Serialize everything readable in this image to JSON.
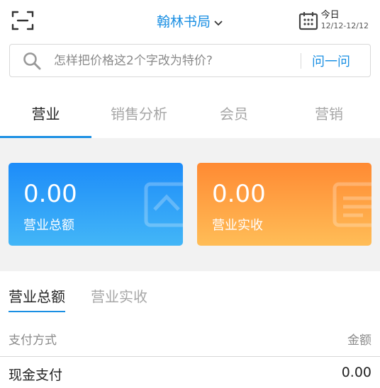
{
  "header": {
    "store_name": "翰林书局",
    "date_label": "今日",
    "date_range": "12/12-12/12",
    "accent_color": "#1a8fe3"
  },
  "search": {
    "placeholder": "怎样把价格这2个字改为特价?",
    "ask_label": "问一问"
  },
  "tabs": [
    {
      "label": "营业",
      "active": true
    },
    {
      "label": "销售分析",
      "active": false
    },
    {
      "label": "会员",
      "active": false
    },
    {
      "label": "营销",
      "active": false
    }
  ],
  "cards": [
    {
      "value": "0.00",
      "label": "营业总额",
      "color": "#1d8cf9"
    },
    {
      "value": "0.00",
      "label": "营业实收",
      "color": "#ff8a33"
    }
  ],
  "subtabs": [
    {
      "label": "营业总额",
      "active": true
    },
    {
      "label": "营业实收",
      "active": false
    }
  ],
  "table": {
    "headers": {
      "method": "支付方式",
      "amount": "金额"
    },
    "rows": [
      {
        "method": "现金支付",
        "amount": "0.00"
      }
    ]
  }
}
